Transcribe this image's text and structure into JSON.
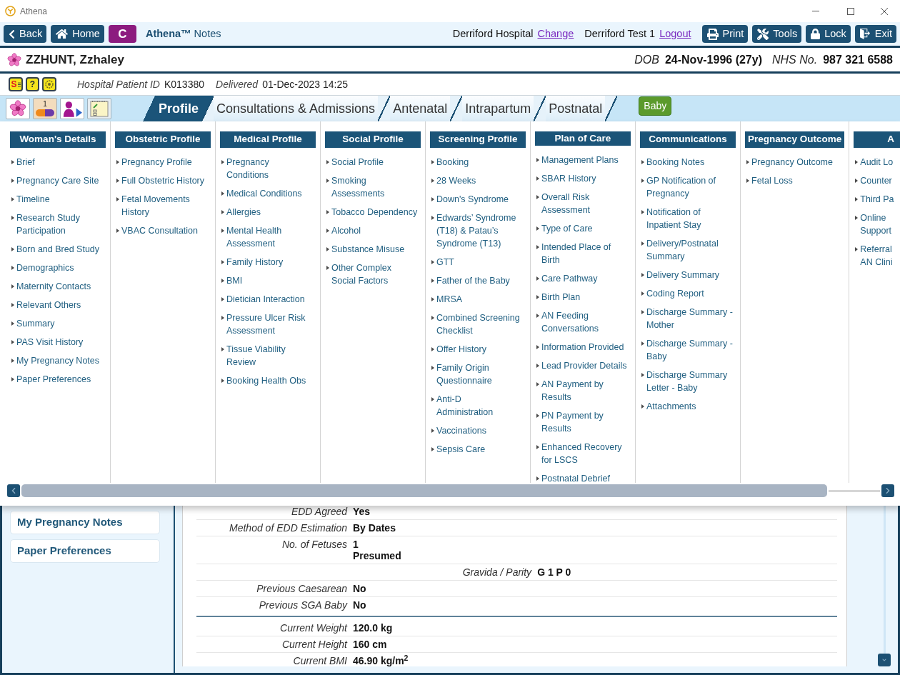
{
  "window": {
    "title": "Athena"
  },
  "toolbar": {
    "left_buttons": [
      {
        "kind": "back",
        "label": "Back"
      },
      {
        "kind": "home",
        "label": "Home"
      },
      {
        "kind": "initial",
        "label": "C"
      }
    ],
    "app_title": "**Athena™** Notes",
    "site": {
      "name": "Derriford Hospital",
      "link": "Change"
    },
    "user": {
      "name": "Derriford Test 1",
      "link": "Logout"
    },
    "right_buttons": [
      {
        "kind": "print",
        "label": "Print"
      },
      {
        "kind": "tools",
        "label": "Tools"
      },
      {
        "kind": "lock",
        "label": "Lock"
      },
      {
        "kind": "exit",
        "label": "Exit"
      }
    ]
  },
  "patient": {
    "name": "ZZHUNT, Zzhaley",
    "details": [
      {
        "label": "DOB",
        "value": "24-Nov-1996 (27y)"
      },
      {
        "label": "NHS No.",
        "value": "987 321 6588"
      }
    ]
  },
  "alerts": [
    {
      "kind": "hand",
      "text": "S"
    },
    {
      "kind": "question",
      "text": "?"
    }
  ],
  "episode": [
    {
      "label": "Hospital Patient ID",
      "value": "K013380"
    },
    {
      "label": "Delivered",
      "value": "01-Dec-2023 14:25"
    }
  ],
  "medications_badge": "1",
  "tabs": [
    {
      "label": "Profile",
      "selected": true
    },
    {
      "label": "Consultations & Admissions",
      "selected": false
    },
    {
      "label": "Antenatal",
      "selected": false
    },
    {
      "label": "Intrapartum",
      "selected": false
    },
    {
      "label": "Postnatal",
      "selected": false
    }
  ],
  "baby_button": {
    "label": "Baby"
  },
  "menu": {
    "columns": [
      {
        "header": "Woman's Details",
        "items": [
          "Brief",
          "Pregnancy Care Site",
          "Timeline",
          "Research Study\nParticipation",
          "Born and Bred Study",
          "Demographics",
          "Maternity Contacts",
          "Relevant Others",
          "Summary",
          "PAS Visit History",
          "My Pregnancy Notes",
          "Paper Preferences"
        ]
      },
      {
        "header": "Obstetric Profile",
        "items": [
          "Pregnancy Profile",
          "Full Obstetric History",
          "Fetal Movements\nHistory",
          "VBAC Consultation"
        ]
      },
      {
        "header": "Medical Profile",
        "items": [
          "Pregnancy\nConditions",
          "Medical Conditions",
          "Allergies",
          "Mental Health\nAssessment",
          "Family History",
          "BMI",
          "Dietician Interaction",
          "Pressure Ulcer Risk\nAssessment",
          "Tissue Viability\nReview",
          "Booking Health Obs"
        ]
      },
      {
        "header": "Social Profile",
        "items": [
          "Social Profile",
          "Smoking\nAssessments",
          "Tobacco Dependency",
          "Alcohol",
          "Substance Misuse",
          "Other Complex\nSocial Factors"
        ]
      },
      {
        "header": "Screening Profile",
        "items": [
          "Booking",
          "28 Weeks",
          "Down's Syndrome",
          "Edwards’ Syndrome\n(T18) & Patau’s\nSyndrome (T13)",
          "GTT",
          "Father of the Baby",
          "MRSA",
          "Combined Screening\nChecklist",
          "Offer History",
          "Family Origin\nQuestionnaire",
          "Anti-D\nAdministration",
          "Vaccinations",
          "Sepsis Care"
        ]
      },
      {
        "header": "Plan of Care",
        "items": [
          "Management Plans",
          "SBAR History",
          "Overall Risk\nAssessment",
          "Type of Care",
          "Intended Place of\nBirth",
          "Care Pathway",
          "Birth Plan",
          "AN Feeding\nConversations",
          "Information Provided",
          "Lead Provider Details",
          "AN Payment by\nResults",
          "PN Payment by\nResults",
          "Enhanced Recovery\nfor LSCS",
          "Postnatal Debrief"
        ]
      },
      {
        "header": "Communications",
        "items": [
          "Booking Notes",
          "GP Notification of\nPregnancy",
          "Notification of\nInpatient Stay",
          "Delivery/Postnatal\nSummary",
          "Delivery Summary",
          "Coding Report",
          "Discharge Summary -\nMother",
          "Discharge Summary -\nBaby",
          "Discharge Summary\nLetter - Baby",
          "Attachments"
        ]
      },
      {
        "header": "Pregnancy Outcome",
        "items": [
          "Pregnancy Outcome",
          "Fetal Loss"
        ]
      },
      {
        "header": "A",
        "items": [
          "Audit Lo",
          "Counter",
          "Third Pa",
          "Online\nSupport",
          "Referral\nAN Clini"
        ]
      }
    ]
  },
  "sidebar": {
    "items": [
      {
        "label": "My Pregnancy Notes"
      },
      {
        "label": "Paper Preferences"
      }
    ]
  },
  "details": {
    "sections": [
      {
        "rows": [
          {
            "kind": "field",
            "label": "EDD Agreed",
            "values": [
              "Yes"
            ]
          },
          {
            "kind": "field",
            "label": "Method of EDD Estimation",
            "values": [
              "By Dates"
            ]
          },
          {
            "kind": "field",
            "label": "No. of Fetuses",
            "values": [
              "1",
              "Presumed"
            ]
          },
          {
            "kind": "centered",
            "label": "Gravida / Parity",
            "values": [
              "G 1 P 0"
            ]
          },
          {
            "kind": "field",
            "label": "Previous Caesarean",
            "values": [
              "No"
            ]
          },
          {
            "kind": "field",
            "label": "Previous SGA Baby",
            "values": [
              "No"
            ]
          }
        ]
      },
      {
        "rows": [
          {
            "kind": "field",
            "label": "Current Weight",
            "values": [
              "120.0 kg"
            ]
          },
          {
            "kind": "field",
            "label": "Current Height",
            "values": [
              "160 cm"
            ]
          },
          {
            "kind": "field",
            "label": "Current BMI",
            "values": [
              "46.90 kg/m$^{2}$"
            ]
          }
        ]
      }
    ]
  }
}
